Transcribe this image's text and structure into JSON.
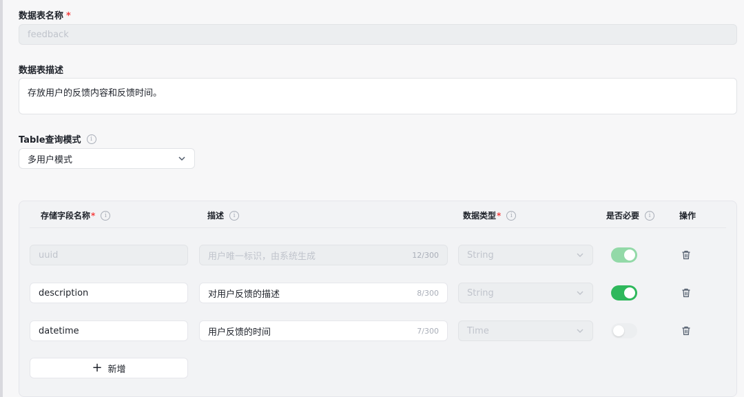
{
  "form": {
    "table_name_label": "数据表名称",
    "required_mark": "*",
    "table_name_value": "feedback",
    "table_desc_label": "数据表描述",
    "table_desc_value": "存放用户的反馈内容和反馈时间。",
    "query_mode_label": "Table查询模式",
    "query_mode_value": "多用户模式"
  },
  "fields_table": {
    "headers": {
      "name": "存储字段名称",
      "desc": "描述",
      "type": "数据类型",
      "required": "是否必要",
      "action": "操作"
    },
    "rows": [
      {
        "name": "uuid",
        "desc": "用户唯一标识，由系统生成",
        "counter": "12/300",
        "type": "String",
        "required": true,
        "locked": true
      },
      {
        "name": "description",
        "desc": "对用户反馈的描述",
        "counter": "8/300",
        "type": "String",
        "required": true,
        "locked": false
      },
      {
        "name": "datetime",
        "desc": "用户反馈的时间",
        "counter": "7/300",
        "type": "Time",
        "required": false,
        "locked": false
      }
    ],
    "add_label": "新增"
  },
  "colors": {
    "accent_green": "#2fb85c",
    "required_red": "#f53f3f"
  },
  "icons": {
    "info": "info-circle-icon",
    "chevron": "chevron-down-icon",
    "trash": "trash-icon",
    "plus": "plus-icon"
  }
}
